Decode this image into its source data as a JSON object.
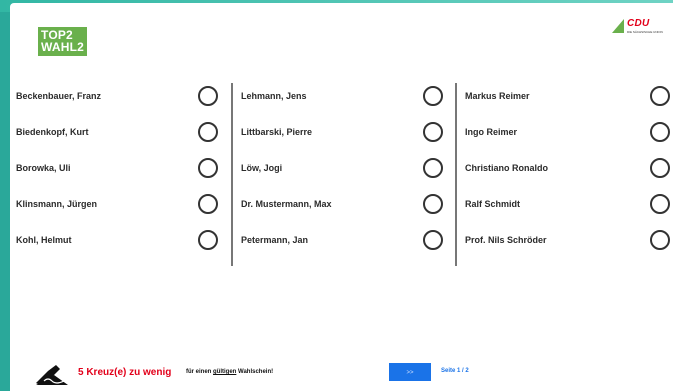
{
  "logo": {
    "line1": "TOP2",
    "line2": "WAHL2"
  },
  "party_logo": {
    "text": "CDU",
    "subtitle": "DIE SÄCHSISCHE UNION"
  },
  "columns": [
    {
      "candidates": [
        "Beckenbauer, Franz",
        "Biedenkopf, Kurt",
        "Borowka, Uli",
        "Klinsmann, Jürgen",
        "Kohl, Helmut"
      ]
    },
    {
      "candidates": [
        "Lehmann, Jens",
        "Littbarski, Pierre",
        "Löw, Jogi",
        "Dr. Mustermann, Max",
        "Petermann, Jan"
      ]
    },
    {
      "candidates": [
        "Markus Reimer",
        "Ingo Reimer",
        "Christiano Ronaldo",
        "Ralf Schmidt",
        "Prof. Nils Schröder"
      ]
    }
  ],
  "footer": {
    "warning": "5 Kreuz(e) zu wenig",
    "hint_prefix": "für einen ",
    "hint_underlined": "gültigen",
    "hint_suffix": " Wahlschein!",
    "next_label": ">>",
    "page_indicator": "Seite 1 / 2"
  },
  "colors": {
    "accent_green": "#6ab04c",
    "warning_red": "#e2001a",
    "button_blue": "#1a73e8",
    "background_teal": "#2aa89a"
  }
}
